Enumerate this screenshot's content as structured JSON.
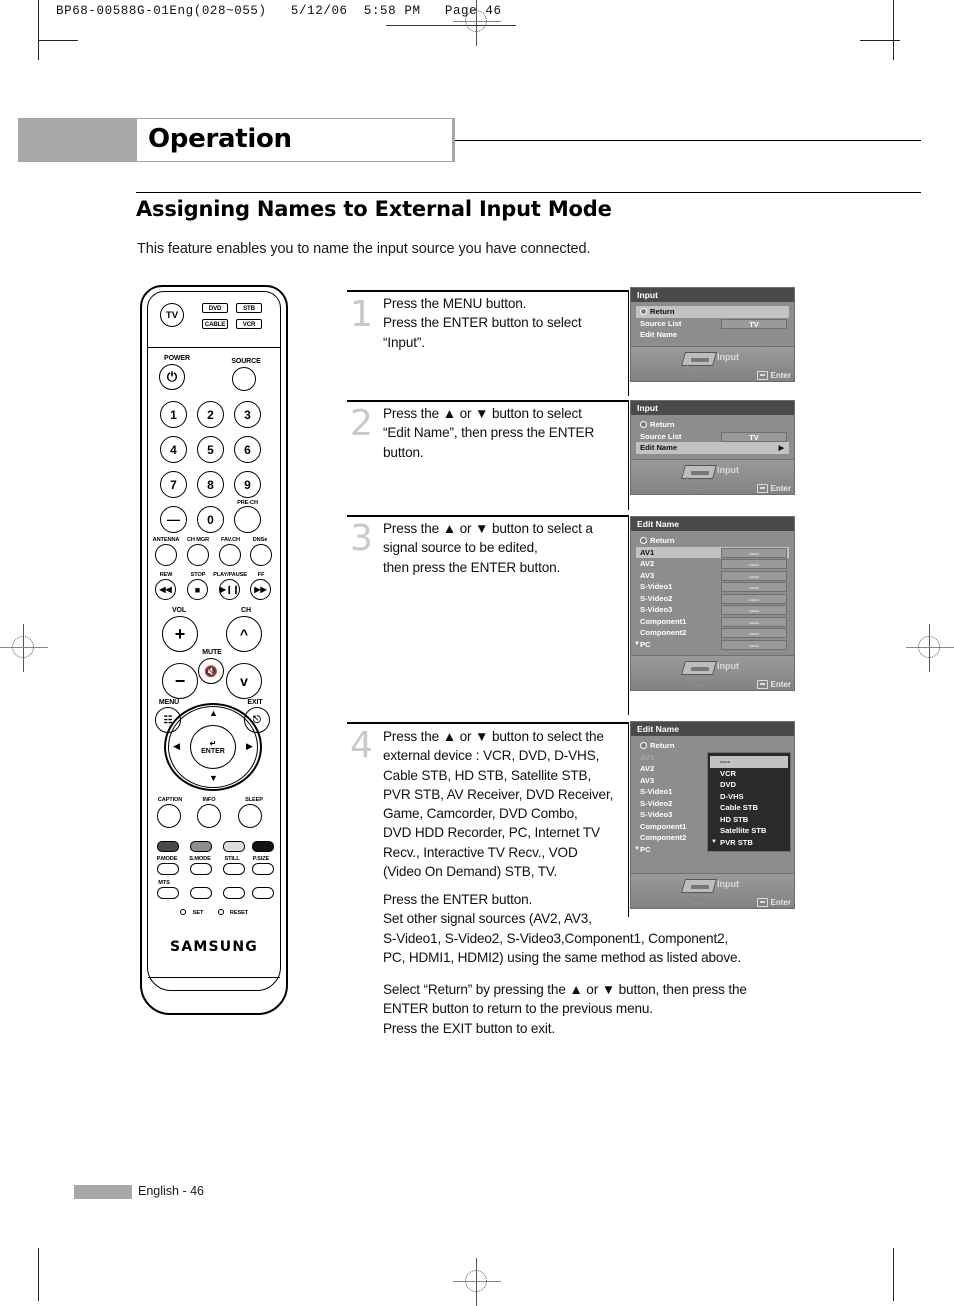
{
  "print_header": {
    "text": "BP68-00588G-01Eng(028~055)   5/12/06  5:58 PM   Page 46"
  },
  "chapter": {
    "title": "Operation"
  },
  "section": {
    "title": "Assigning Names to External Input Mode",
    "intro": "This feature enables you to name the input source you have connected."
  },
  "steps": [
    {
      "number": "1",
      "text": "Press the MENU button.\nPress the ENTER button to select\n“Input”."
    },
    {
      "number": "2",
      "text": "Press the ▲ or ▼ button to  select\n“Edit Name”, then press the ENTER\nbutton."
    },
    {
      "number": "3",
      "text": "Press the ▲ or ▼ button to select a\nsignal source to be edited,\nthen press the ENTER button."
    },
    {
      "number": "4",
      "text": "Press the ▲ or ▼ button to select the\nexternal device : VCR, DVD, D-VHS,\nCable STB, HD STB, Satellite STB,\nPVR STB, AV Receiver, DVD Receiver,\nGame, Camcorder, DVD Combo,\nDVD HDD Recorder, PC, Internet TV\nRecv., Interactive TV Recv., VOD\n(Video On Demand) STB, TV."
    }
  ],
  "step4_extra": {
    "paragraph1": "Press the ENTER button.\nSet other signal sources (AV2, AV3,\nS-Video1, S-Video2, S-Video3,Component1, Component2,\nPC, HDMI1, HDMI2) using the same method as listed above.",
    "paragraph2": "Select “Return” by pressing the ▲ or ▼ button, then press the\nENTER button to return to the previous menu.\nPress the EXIT button to exit."
  },
  "osd": {
    "footer_input_label": "Input",
    "footer_enter_label": "Enter",
    "panel1": {
      "title": "Input",
      "rows": [
        {
          "label": "Return",
          "selected": true,
          "icon": "return-icon"
        },
        {
          "label": "Source List",
          "value": "TV"
        },
        {
          "label": "Edit Name"
        }
      ]
    },
    "panel2": {
      "title": "Input",
      "rows": [
        {
          "label": "Return",
          "icon": "return-icon"
        },
        {
          "label": "Source List",
          "value": "TV"
        },
        {
          "label": "Edit Name",
          "selected": true,
          "arrow": "▶"
        }
      ]
    },
    "panel3": {
      "title": "Edit Name",
      "rows": [
        {
          "label": "Return",
          "icon": "return-icon"
        },
        {
          "label": "AV1",
          "value": "----",
          "selected": true
        },
        {
          "label": "AV2",
          "value": "----"
        },
        {
          "label": "AV3",
          "value": "----"
        },
        {
          "label": "S-Video1",
          "value": "----"
        },
        {
          "label": "S-Video2",
          "value": "----"
        },
        {
          "label": "S-Video3",
          "value": "----"
        },
        {
          "label": "Component1",
          "value": "----"
        },
        {
          "label": "Component2",
          "value": "----"
        },
        {
          "label": "PC",
          "value": "----",
          "caret": "▼"
        }
      ]
    },
    "panel4": {
      "title": "Edit Name",
      "rows": [
        {
          "label": "Return",
          "icon": "return-icon"
        },
        {
          "label": "AV1",
          "dim": true
        },
        {
          "label": "AV2"
        },
        {
          "label": "AV3"
        },
        {
          "label": "S-Video1"
        },
        {
          "label": "S-Video2"
        },
        {
          "label": "S-Video3"
        },
        {
          "label": "Component1"
        },
        {
          "label": "Component2"
        },
        {
          "label": "PC",
          "caret": "▼"
        }
      ],
      "dropdown": [
        {
          "label": "----",
          "selected": true
        },
        {
          "label": "VCR"
        },
        {
          "label": "DVD"
        },
        {
          "label": "D-VHS"
        },
        {
          "label": "Cable STB"
        },
        {
          "label": "HD STB"
        },
        {
          "label": "Satellite STB"
        },
        {
          "label": "PVR STB",
          "caret": "▼"
        }
      ]
    }
  },
  "remote": {
    "brand": "SAMSUNG",
    "mode_buttons": [
      "TV",
      "DVD",
      "STB",
      "CABLE",
      "VCR"
    ],
    "power_label": "POWER",
    "source_label": "SOURCE",
    "numbers": [
      "1",
      "2",
      "3",
      "4",
      "5",
      "6",
      "7",
      "8",
      "9",
      "0"
    ],
    "pre_ch_label": "PRE-CH",
    "fn_labels": [
      "ANTENNA",
      "CH MGR",
      "FAV.CH",
      "DNSe"
    ],
    "transport_labels": [
      "REW",
      "STOP",
      "PLAY/PAUSE",
      "FF"
    ],
    "vol_label": "VOL",
    "ch_label": "CH",
    "mute_label": "MUTE",
    "menu_label": "MENU",
    "exit_label": "EXIT",
    "enter_label": "ENTER",
    "lower_labels": [
      "CAPTION",
      "INFO",
      "SLEEP"
    ],
    "mode_row_labels": [
      "P.MODE",
      "S.MODE",
      "STILL",
      "P.SIZE"
    ],
    "mts_label": "MTS",
    "set_label": "SET",
    "reset_label": "RESET"
  },
  "footer": {
    "page_label": "English - 46"
  },
  "colors": {
    "chapter_bar": "#a8a8a8",
    "osd_title_bar": "#4a4a4a",
    "osd_panel": "#8d8d8d",
    "osd_highlight": "#c2c2c2",
    "osd_dropdown": "#2a2a2a",
    "step_number": "#c9c9c9"
  }
}
